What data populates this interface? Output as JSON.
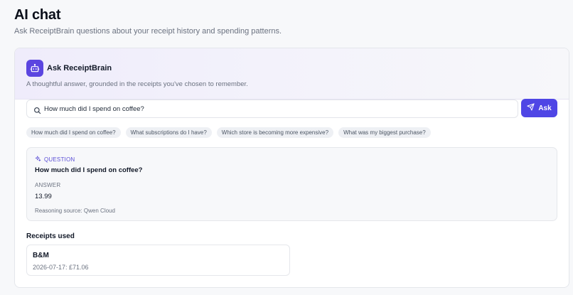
{
  "page": {
    "title": "AI chat",
    "subtitle": "Ask ReceiptBrain questions about your receipt history and spending patterns."
  },
  "assistant": {
    "title": "Ask ReceiptBrain",
    "description": "A thoughtful answer, grounded in the receipts you've chosen to remember.",
    "icon": "robot-icon",
    "accent_color": "#5b45e0"
  },
  "search": {
    "value": "How much did I spend on coffee?",
    "icon": "search-icon",
    "button_label": "Ask",
    "button_icon": "send-icon",
    "button_color": "#4f46e5"
  },
  "suggestions": [
    "How much did I spend on coffee?",
    "What subscriptions do I have?",
    "Which store is becoming more expensive?",
    "What was my biggest purchase?"
  ],
  "result": {
    "question_label": "QUESTION",
    "question_icon": "sparkle-icon",
    "question": "How much did I spend on coffee?",
    "answer_label": "ANSWER",
    "answer": "13.99",
    "source": "Reasoning source: Qwen Cloud"
  },
  "receipts": {
    "heading": "Receipts used",
    "items": [
      {
        "store": "B&M",
        "detail": "2026-07-17: £71.06"
      }
    ]
  }
}
